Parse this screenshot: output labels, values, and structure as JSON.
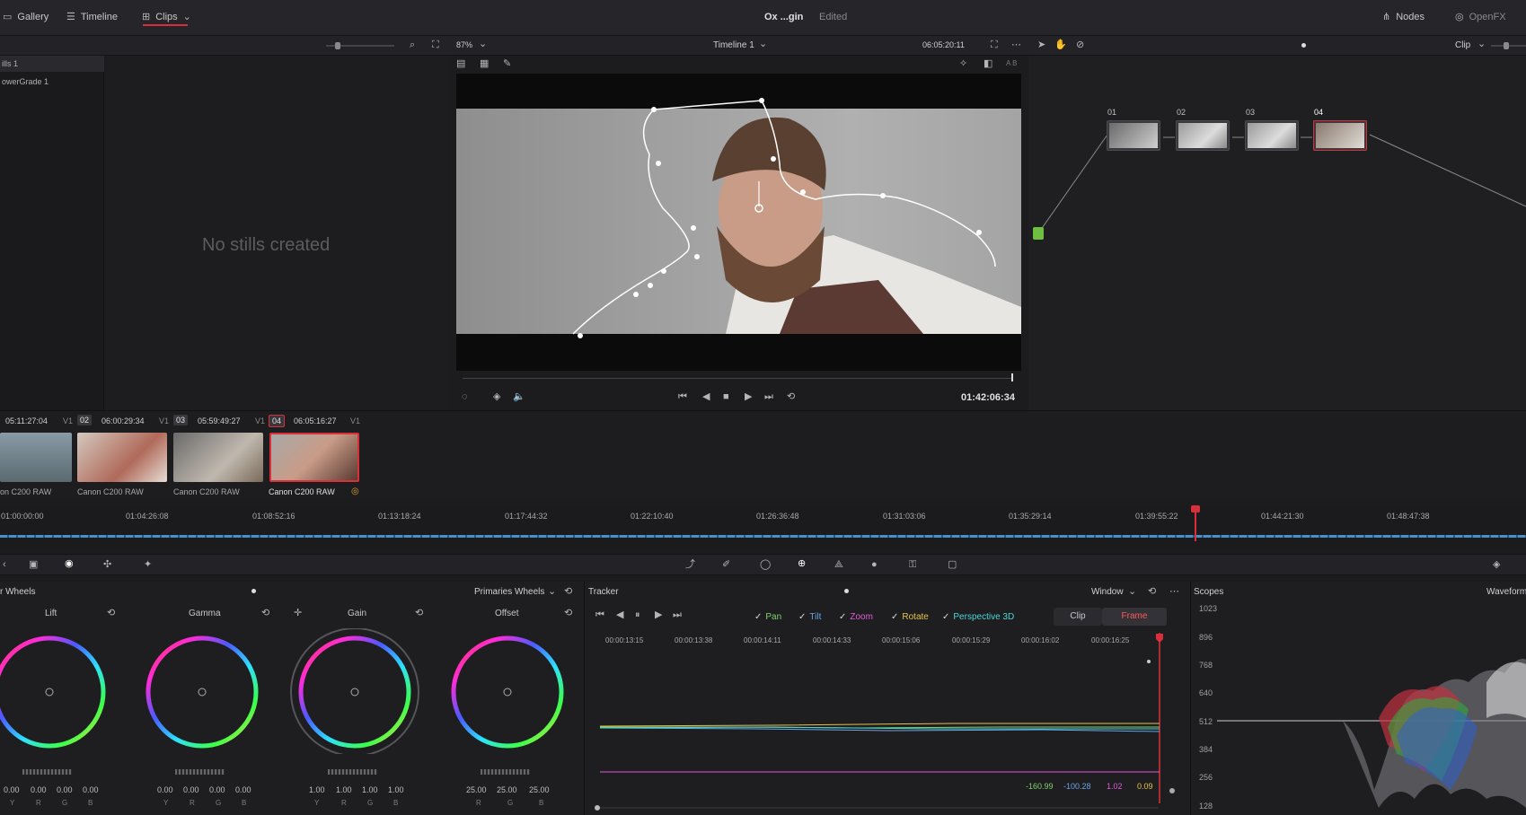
{
  "topbar": {
    "gallery": "Gallery",
    "timeline": "Timeline",
    "clips": "Clips",
    "project_title": "Ox ...gin",
    "status": "Edited",
    "nodes": "Nodes",
    "openfx": "OpenFX"
  },
  "viewer": {
    "zoom": "87%",
    "timeline_name": "Timeline 1",
    "source_tc": "06:05:20:11",
    "current_tc": "01:42:06:34",
    "mode": "Clip"
  },
  "gallery": {
    "stills": [
      "ills 1",
      "owerGrade 1"
    ],
    "empty_message": "No stills created"
  },
  "clips": [
    {
      "num": "",
      "tc": "05:11:27:04",
      "track": "V1",
      "label": "on C200 RAW"
    },
    {
      "num": "02",
      "tc": "06:00:29:34",
      "track": "V1",
      "label": "Canon C200 RAW"
    },
    {
      "num": "03",
      "tc": "05:59:49:27",
      "track": "V1",
      "label": "Canon C200 RAW"
    },
    {
      "num": "04",
      "tc": "06:05:16:27",
      "track": "V1",
      "label": "Canon C200 RAW"
    }
  ],
  "nodes": [
    "01",
    "02",
    "03",
    "04"
  ],
  "ruler": [
    "01:00:00:00",
    "01:04:26:08",
    "01:08:52:16",
    "01:13:18:24",
    "01:17:44:32",
    "01:22:10:40",
    "01:26:36:48",
    "01:31:03:06",
    "01:35:29:14",
    "01:39:55:22",
    "01:44:21:30",
    "01:48:47:38"
  ],
  "wheels": {
    "title": "r Wheels",
    "mode": "Primaries Wheels",
    "items": [
      {
        "name": "Lift",
        "values": [
          "0.00",
          "0.00",
          "0.00",
          "0.00"
        ],
        "channels": [
          "Y",
          "R",
          "G",
          "B"
        ]
      },
      {
        "name": "Gamma",
        "values": [
          "0.00",
          "0.00",
          "0.00",
          "0.00"
        ],
        "channels": [
          "Y",
          "R",
          "G",
          "B"
        ]
      },
      {
        "name": "Gain",
        "values": [
          "1.00",
          "1.00",
          "1.00",
          "1.00"
        ],
        "channels": [
          "Y",
          "R",
          "G",
          "B"
        ]
      },
      {
        "name": "Offset",
        "values": [
          "25.00",
          "25.00",
          "25.00"
        ],
        "channels": [
          "R",
          "G",
          "B"
        ]
      }
    ]
  },
  "tracker": {
    "title": "Tracker",
    "window": "Window",
    "checks": [
      "Pan",
      "Tilt",
      "Zoom",
      "Rotate",
      "Perspective 3D"
    ],
    "clip": "Clip",
    "frame": "Frame",
    "ticks": [
      "00:00:13:15",
      "00:00:13:38",
      "00:00:14:11",
      "00:00:14:33",
      "00:00:15:06",
      "00:00:15:29",
      "00:00:16:02",
      "00:00:16:25"
    ],
    "readouts": [
      "-160.99",
      "-100.28",
      "1.02",
      "0.09"
    ]
  },
  "scopes": {
    "title": "Scopes",
    "type": "Waveform",
    "ticks": [
      "1023",
      "896",
      "768",
      "640",
      "512",
      "384",
      "256",
      "128"
    ]
  },
  "colors": {
    "accent_red": "#d8303a",
    "pan": "#7fd16a",
    "tilt": "#6aa4e6",
    "zoom": "#e05ad7",
    "rotate": "#e6c24a",
    "persp": "#4bd6d6"
  }
}
